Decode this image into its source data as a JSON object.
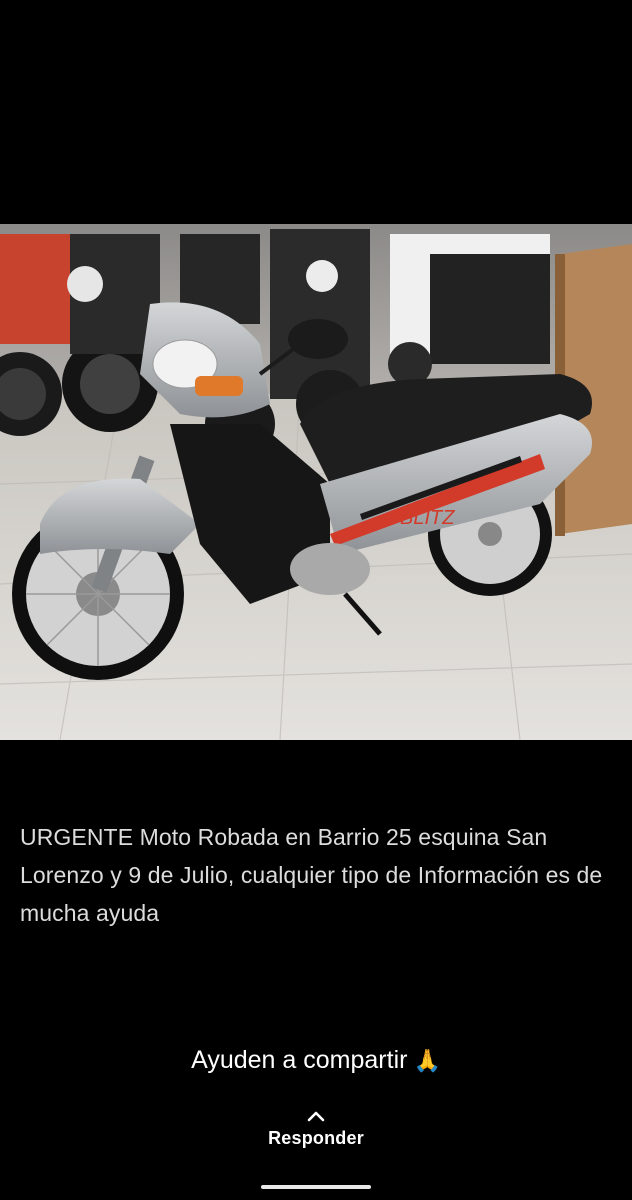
{
  "post": {
    "caption": "URGENTE Moto Robada en Barrio 25 esquina San Lorenzo y 9 de Julio, cualquier tipo de Información es de mucha ayuda",
    "share_text": "Ayuden a compartir",
    "share_emoji": "🙏",
    "photo_badge": "BLITZ"
  },
  "footer": {
    "reply_label": "Responder",
    "chevron_icon": "chevron-up-icon"
  },
  "colors": {
    "background": "#000000",
    "caption_text": "#dcdcdc",
    "accent_red": "#d23a2a"
  }
}
